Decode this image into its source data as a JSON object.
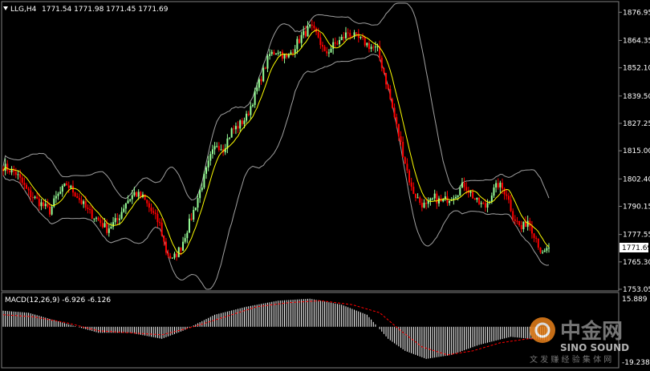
{
  "header": {
    "symbol": "LLG,H4",
    "ohlc": "1771.54 1771.98 1771.45 1771.69",
    "arrow": "triangle-down"
  },
  "macd_header": "MACD(12,26,9) -6.926 -6.126",
  "watermark": {
    "brand_cn": "中金网",
    "brand_en": "SINO SOUND",
    "slogan": "文 发 赚 经 验 集 体 网"
  },
  "colors": {
    "background": "#000000",
    "bull": "#98ff98",
    "bear": "#ff0000",
    "ma": "#ffff00",
    "bands": "#a0a0a0",
    "macd_hist": "#ffffff",
    "macd_signal": "#ff0000",
    "price_tag_bg": "#ffffff"
  },
  "chart_data": [
    {
      "type": "candlestick",
      "title": "LLG,H4",
      "yticks": [
        "1876.95",
        "1864.35",
        "1852.10",
        "1839.50",
        "1827.25",
        "1815.00",
        "1802.40",
        "1790.15",
        "1777.55",
        "1765.30",
        "1753.05"
      ],
      "ylim": [
        1753.05,
        1881
      ],
      "current_price": "1771.69",
      "indicators": [
        "Bollinger Bands",
        "Moving Average"
      ],
      "close_path": [
        [
          0,
          1808
        ],
        [
          6,
          1805
        ],
        [
          12,
          1796
        ],
        [
          17,
          1792
        ],
        [
          22,
          1788
        ],
        [
          25,
          1794
        ],
        [
          30,
          1800
        ],
        [
          34,
          1796
        ],
        [
          40,
          1788
        ],
        [
          45,
          1784
        ],
        [
          49,
          1780
        ],
        [
          54,
          1784
        ],
        [
          58,
          1792
        ],
        [
          62,
          1796
        ],
        [
          66,
          1794
        ],
        [
          70,
          1788
        ],
        [
          74,
          1782
        ],
        [
          77,
          1770
        ],
        [
          80,
          1766
        ],
        [
          84,
          1772
        ],
        [
          87,
          1780
        ],
        [
          90,
          1788
        ],
        [
          94,
          1800
        ],
        [
          98,
          1812
        ],
        [
          101,
          1818
        ],
        [
          104,
          1816
        ],
        [
          108,
          1824
        ],
        [
          111,
          1826
        ],
        [
          115,
          1830
        ],
        [
          119,
          1840
        ],
        [
          122,
          1848
        ],
        [
          126,
          1858
        ],
        [
          130,
          1860
        ],
        [
          134,
          1856
        ],
        [
          138,
          1862
        ],
        [
          141,
          1866
        ],
        [
          145,
          1870
        ],
        [
          149,
          1866
        ],
        [
          152,
          1858
        ],
        [
          156,
          1862
        ],
        [
          159,
          1864
        ],
        [
          163,
          1868
        ],
        [
          166,
          1866
        ],
        [
          170,
          1864
        ],
        [
          173,
          1862
        ],
        [
          177,
          1860
        ],
        [
          180,
          1850
        ],
        [
          183,
          1838
        ],
        [
          187,
          1822
        ],
        [
          190,
          1810
        ],
        [
          193,
          1798
        ],
        [
          197,
          1792
        ],
        [
          200,
          1790
        ],
        [
          204,
          1794
        ],
        [
          207,
          1792
        ],
        [
          211,
          1794
        ],
        [
          214,
          1796
        ],
        [
          218,
          1800
        ],
        [
          221,
          1796
        ],
        [
          224,
          1792
        ],
        [
          228,
          1790
        ],
        [
          231,
          1796
        ],
        [
          234,
          1800
        ],
        [
          238,
          1796
        ],
        [
          241,
          1786
        ],
        [
          245,
          1780
        ],
        [
          248,
          1784
        ],
        [
          252,
          1776
        ],
        [
          255,
          1768
        ],
        [
          258,
          1771.69
        ]
      ]
    },
    {
      "type": "macd",
      "title": "MACD(12,26,9) -6.926 -6.126",
      "yticks": [
        "15.889",
        "-19.238"
      ],
      "ylim": [
        -19.238,
        15.889
      ],
      "hist_path": [
        [
          0,
          8
        ],
        [
          12,
          7
        ],
        [
          25,
          3
        ],
        [
          35,
          0
        ],
        [
          45,
          -3
        ],
        [
          60,
          -3
        ],
        [
          75,
          -6
        ],
        [
          85,
          -2
        ],
        [
          100,
          6
        ],
        [
          115,
          10
        ],
        [
          130,
          13
        ],
        [
          145,
          14
        ],
        [
          160,
          11
        ],
        [
          172,
          6
        ],
        [
          182,
          -6
        ],
        [
          190,
          -12
        ],
        [
          200,
          -16
        ],
        [
          212,
          -14
        ],
        [
          225,
          -9
        ],
        [
          240,
          -5
        ],
        [
          258,
          -6.926
        ]
      ],
      "signal_path": [
        [
          0,
          6
        ],
        [
          14,
          5
        ],
        [
          30,
          2
        ],
        [
          45,
          -2
        ],
        [
          60,
          -3
        ],
        [
          75,
          -4
        ],
        [
          90,
          0
        ],
        [
          105,
          5
        ],
        [
          120,
          10
        ],
        [
          135,
          12
        ],
        [
          150,
          13
        ],
        [
          165,
          11
        ],
        [
          178,
          7
        ],
        [
          188,
          -2
        ],
        [
          198,
          -10
        ],
        [
          210,
          -14
        ],
        [
          222,
          -12
        ],
        [
          235,
          -8
        ],
        [
          248,
          -6
        ],
        [
          258,
          -6.126
        ]
      ]
    }
  ]
}
